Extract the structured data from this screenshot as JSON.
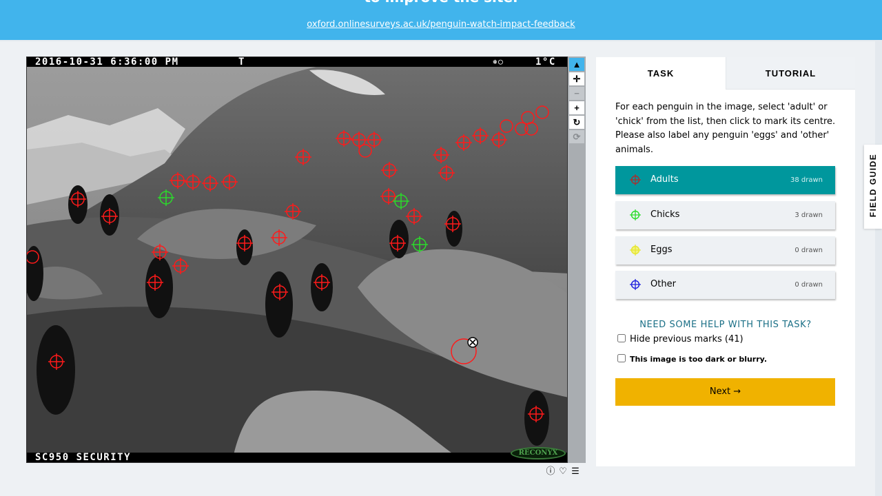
{
  "banner": {
    "title": "to improve the site.",
    "link": "oxford.onlinesurveys.ac.uk/penguin-watch-impact-feedback"
  },
  "subject": {
    "camera_date": "2016-10-31 6:36:00 PM",
    "camera_flag": "T",
    "camera_moon": "❅◯",
    "camera_temp": "1°C",
    "camera_model": "SC950 SECURITY",
    "logo": "RECONYX",
    "marks_color_adult": "#ff1a1a",
    "marks_color_chick": "#2bdc2b"
  },
  "toolbar": {
    "tools": [
      {
        "name": "pointer",
        "glyph": "▲"
      },
      {
        "name": "move",
        "glyph": "✛"
      },
      {
        "name": "zoom-out",
        "glyph": "−"
      },
      {
        "name": "zoom-in",
        "glyph": "+"
      },
      {
        "name": "rotate",
        "glyph": "↻"
      },
      {
        "name": "reset",
        "glyph": "⟳"
      }
    ],
    "meta": [
      "ⓘ",
      "♡",
      "☰"
    ]
  },
  "panel": {
    "tab_task": "TASK",
    "tab_tutorial": "TUTORIAL",
    "instructions": "For each penguin in the image, select 'adult' or 'chick' from the list, then click to mark its centre. Please also label any penguin 'eggs' and 'other' animals.",
    "choices": [
      {
        "label": "Adults",
        "count": "38 drawn",
        "color": "#a83030"
      },
      {
        "label": "Chicks",
        "count": "3 drawn",
        "color": "#2bdc2b"
      },
      {
        "label": "Eggs",
        "count": "0 drawn",
        "color": "#e6e632"
      },
      {
        "label": "Other",
        "count": "0 drawn",
        "color": "#2020dd"
      }
    ],
    "help": "NEED SOME HELP WITH THIS TASK?",
    "hide_marks": "Hide previous marks (41)",
    "too_dark": "This image is too dark or blurry.",
    "next": "Next →"
  },
  "field_guide": "FIELD GUIDE"
}
